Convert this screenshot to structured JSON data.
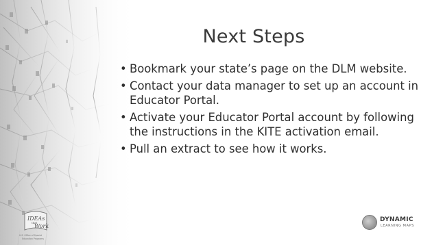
{
  "slide": {
    "title": "Next Steps",
    "bullets": [
      "Bookmark your state’s page on the DLM website.",
      "Contact your data manager to set up an account in Educator Portal.",
      "Activate your Educator Portal account by following the instructions in the KITE activation email.",
      "Pull an extract to see how it works."
    ],
    "bullet_symbol": "•"
  },
  "logos": {
    "left": {
      "text_line1": "IDEAs",
      "text_line2": "that",
      "text_line3": "Work",
      "caption": "U.S. Office of Special Education Programs"
    },
    "right": {
      "main": "DYNAMIC",
      "sub": "LEARNING MAPS"
    }
  },
  "colors": {
    "background": "#ffffff",
    "text": "#2f2f2f",
    "title": "#3a3a3a",
    "texture_gray": "#cfcfcf"
  }
}
